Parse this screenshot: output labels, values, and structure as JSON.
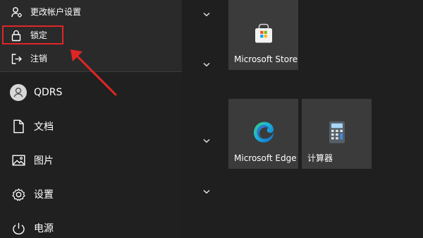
{
  "flyout": {
    "items": [
      {
        "label": "更改帐户设置",
        "icon": "user-settings-icon"
      },
      {
        "label": "锁定",
        "icon": "lock-icon"
      },
      {
        "label": "注销",
        "icon": "sign-out-icon"
      }
    ]
  },
  "main_menu": {
    "user_label": "QDRS",
    "items": [
      {
        "label": "文档",
        "icon": "document-icon"
      },
      {
        "label": "图片",
        "icon": "picture-icon"
      },
      {
        "label": "设置",
        "icon": "gear-icon"
      },
      {
        "label": "电源",
        "icon": "power-icon"
      }
    ]
  },
  "tiles": [
    {
      "label": "Microsoft Store",
      "icon": "microsoft-store-icon"
    },
    {
      "label": "Microsoft Edge",
      "icon": "edge-icon"
    },
    {
      "label": "计算器",
      "icon": "calculator-icon"
    }
  ],
  "colors": {
    "highlight": "#e12525",
    "tile_background": "#3b3b3b",
    "panel_background": "#202020"
  }
}
